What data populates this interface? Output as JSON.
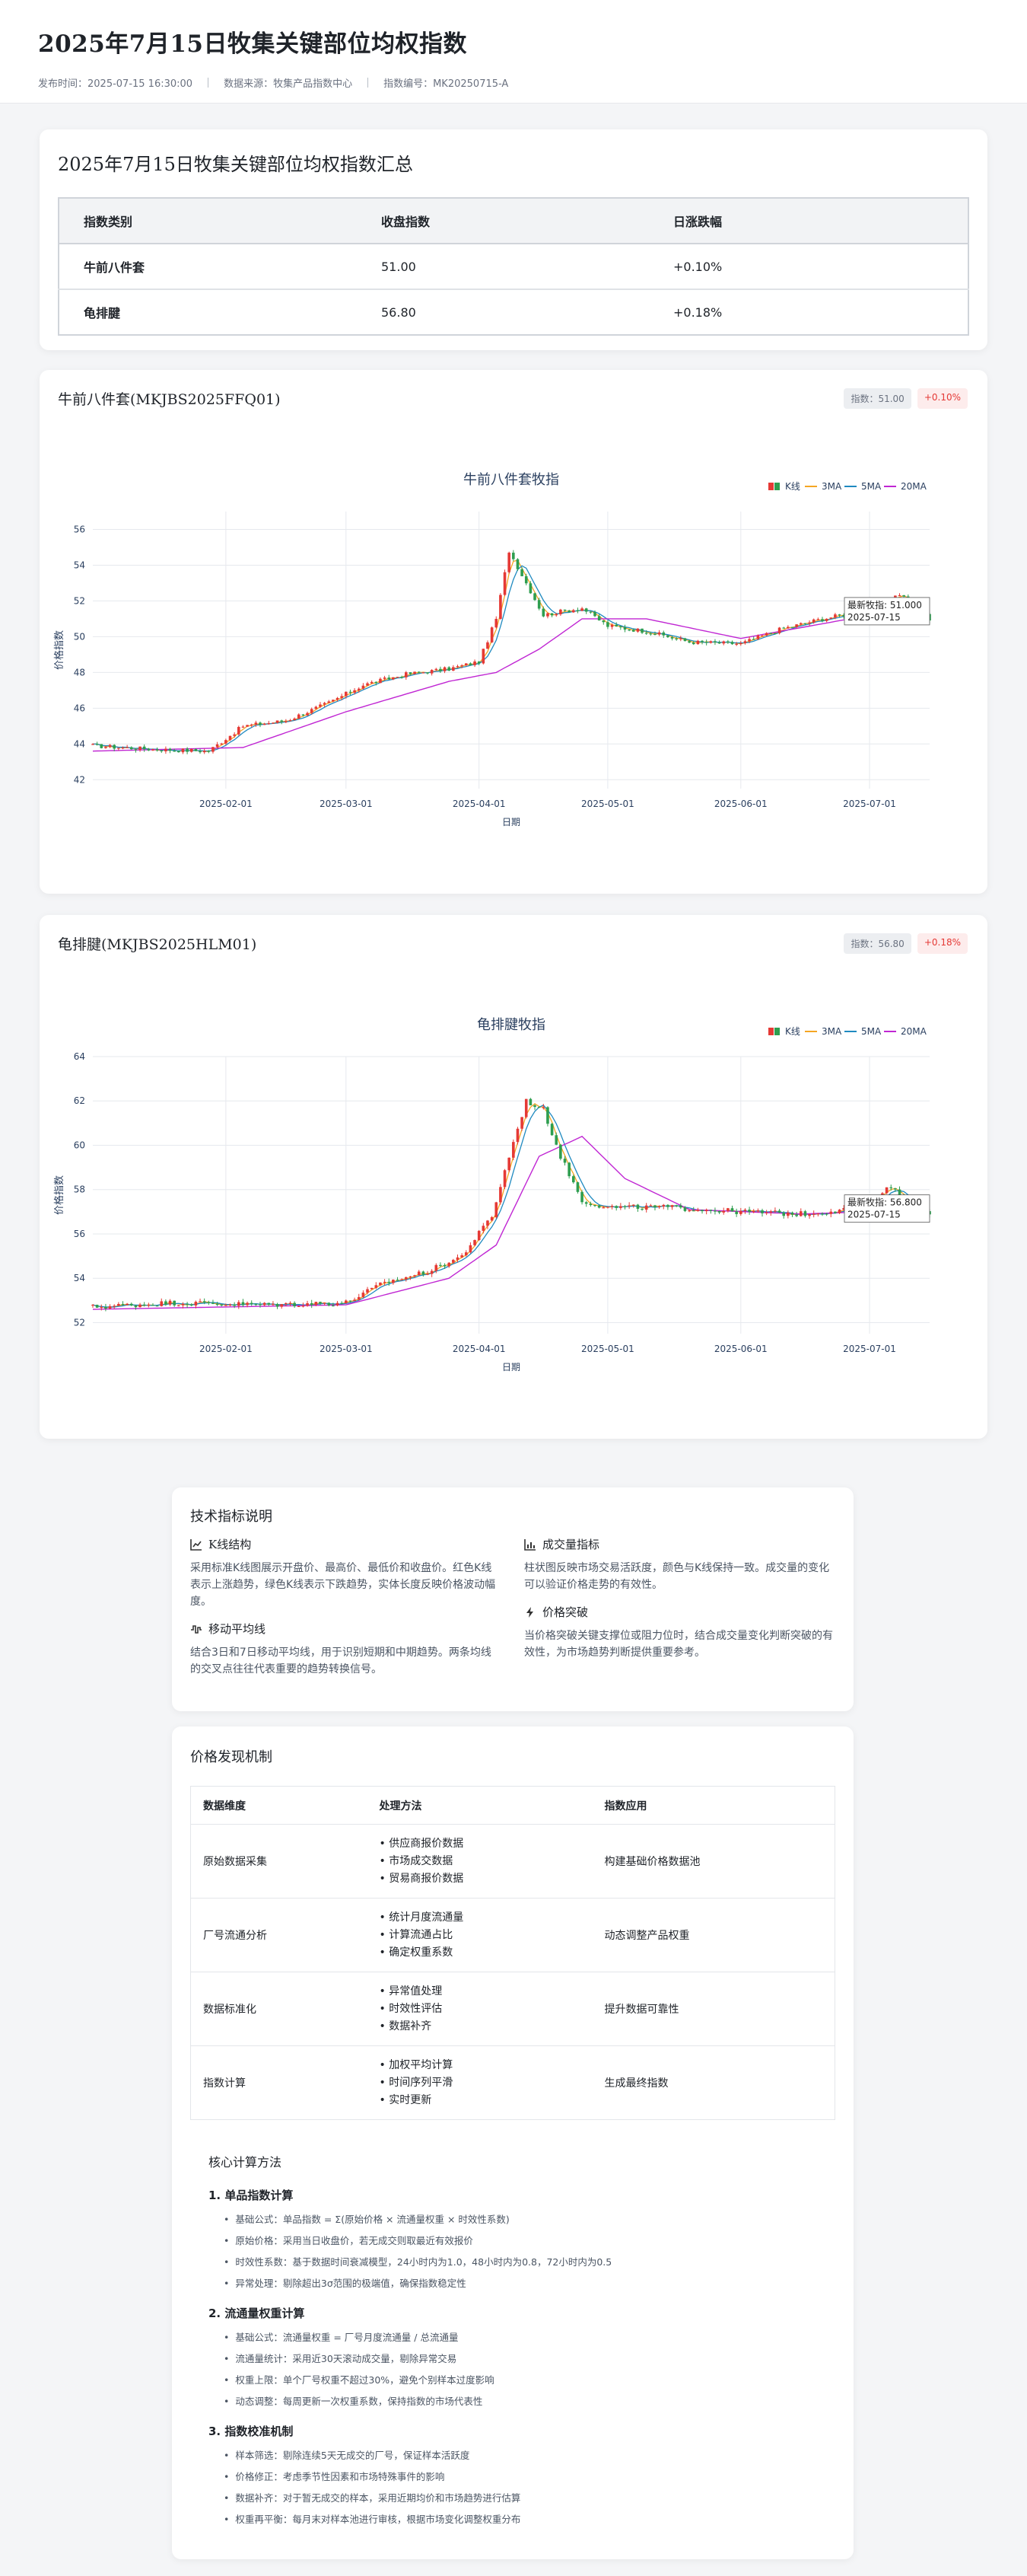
{
  "header": {
    "title": "2025年7月15日牧集关键部位均权指数",
    "publish_time": "发布时间：2025-07-15 16:30:00",
    "source": "数据来源：牧集产品指数中心",
    "index_no": "指数编号：MK20250715-A"
  },
  "summary": {
    "title": "2025年7月15日牧集关键部位均权指数汇总",
    "headers": [
      "指数类别",
      "收盘指数",
      "日涨跌幅"
    ],
    "rows": [
      [
        "牛前八件套",
        "51.00",
        "+0.10%"
      ],
      [
        "龟排腱",
        "56.80",
        "+0.18%"
      ]
    ]
  },
  "charts": [
    {
      "card_title": "牛前八件套(MKJBS2025FFQ01)",
      "badge_index": "指数：51.00",
      "badge_change": "+0.10%"
    },
    {
      "card_title": "龟排腱(MKJBS2025HLM01)",
      "badge_index": "指数：56.80",
      "badge_change": "+0.18%"
    }
  ],
  "chart_data": [
    {
      "type": "line",
      "title": "牛前八件套牧指",
      "xlabel": "日期",
      "ylabel": "价格指数",
      "x_ticks": [
        "2025-02-01",
        "2025-03-01",
        "2025-04-01",
        "2025-05-01",
        "2025-06-01",
        "2025-07-01"
      ],
      "ylim": [
        41.5,
        57
      ],
      "y_ticks": [
        42,
        44,
        46,
        48,
        50,
        52,
        54,
        56
      ],
      "legend": [
        "K线",
        "3MA",
        "5MA",
        "20MA"
      ],
      "legend_position": "top-right",
      "grid": true,
      "annotation": {
        "label": "最新牧指: 51.000",
        "date": "2025-07-15",
        "value": 51.0
      },
      "x_range": [
        "2025-01-01",
        "2025-07-15"
      ],
      "series": [
        {
          "name": "K线",
          "x": [
            "2025-01-01",
            "2025-01-15",
            "2025-01-28",
            "2025-02-05",
            "2025-02-15",
            "2025-02-25",
            "2025-03-05",
            "2025-03-15",
            "2025-03-25",
            "2025-04-01",
            "2025-04-05",
            "2025-04-08",
            "2025-04-12",
            "2025-04-16",
            "2025-04-20",
            "2025-04-25",
            "2025-05-01",
            "2025-05-10",
            "2025-05-20",
            "2025-06-01",
            "2025-06-10",
            "2025-06-20",
            "2025-07-01",
            "2025-07-08",
            "2025-07-15"
          ],
          "values": [
            43.9,
            43.7,
            43.6,
            45.0,
            45.3,
            46.3,
            47.3,
            47.9,
            48.2,
            48.6,
            51.0,
            54.8,
            53.0,
            51.2,
            51.4,
            51.6,
            50.6,
            50.3,
            49.7,
            49.6,
            50.4,
            51.0,
            51.5,
            52.4,
            51.0
          ]
        },
        {
          "name": "20MA",
          "x": [
            "2025-01-01",
            "2025-02-05",
            "2025-03-01",
            "2025-03-25",
            "2025-04-05",
            "2025-04-15",
            "2025-04-25",
            "2025-05-10",
            "2025-06-01",
            "2025-07-01",
            "2025-07-15"
          ],
          "values": [
            43.6,
            43.8,
            45.8,
            47.5,
            48.0,
            49.3,
            51.0,
            51.0,
            49.9,
            51.2,
            51.6
          ]
        }
      ]
    },
    {
      "type": "line",
      "title": "龟排腱牧指",
      "xlabel": "日期",
      "ylabel": "价格指数",
      "x_ticks": [
        "2025-02-01",
        "2025-03-01",
        "2025-04-01",
        "2025-05-01",
        "2025-06-01",
        "2025-07-01"
      ],
      "ylim": [
        51.5,
        64
      ],
      "y_ticks": [
        52,
        54,
        56,
        58,
        60,
        62,
        64
      ],
      "legend": [
        "K线",
        "3MA",
        "5MA",
        "20MA"
      ],
      "legend_position": "top-right",
      "grid": true,
      "annotation": {
        "label": "最新牧指: 56.800",
        "date": "2025-07-15",
        "value": 56.8
      },
      "x_range": [
        "2025-01-01",
        "2025-07-15"
      ],
      "series": [
        {
          "name": "K线",
          "x": [
            "2025-01-01",
            "2025-01-20",
            "2025-02-10",
            "2025-03-01",
            "2025-03-10",
            "2025-03-20",
            "2025-03-28",
            "2025-04-04",
            "2025-04-08",
            "2025-04-12",
            "2025-04-16",
            "2025-04-20",
            "2025-04-25",
            "2025-05-01",
            "2025-05-15",
            "2025-06-01",
            "2025-06-15",
            "2025-07-01",
            "2025-07-05",
            "2025-07-10",
            "2025-07-15"
          ],
          "values": [
            52.7,
            52.9,
            52.8,
            52.9,
            53.8,
            54.3,
            55.0,
            56.8,
            59.5,
            62.0,
            61.6,
            59.5,
            57.5,
            57.2,
            57.2,
            57.0,
            56.9,
            57.2,
            58.2,
            57.5,
            56.8
          ]
        },
        {
          "name": "20MA",
          "x": [
            "2025-01-01",
            "2025-03-01",
            "2025-03-25",
            "2025-04-05",
            "2025-04-15",
            "2025-04-25",
            "2025-05-05",
            "2025-05-20",
            "2025-06-15",
            "2025-07-01",
            "2025-07-15"
          ],
          "values": [
            52.6,
            52.8,
            54.0,
            55.5,
            59.5,
            60.4,
            58.5,
            57.1,
            56.9,
            57.0,
            57.5
          ]
        }
      ]
    }
  ],
  "tech": {
    "title": "技术指标说明",
    "items": [
      {
        "icon": "chart-line-icon",
        "title": "K线结构",
        "text": "采用标准K线图展示开盘价、最高价、最低价和收盘价。红色K线表示上涨趋势，绿色K线表示下跌趋势，实体长度反映价格波动幅度。"
      },
      {
        "icon": "bar-chart-icon",
        "title": "成交量指标",
        "text": "柱状图反映市场交易活跃度，颜色与K线保持一致。成交量的变化可以验证价格走势的有效性。"
      },
      {
        "icon": "wave-icon",
        "title": "移动平均线",
        "text": "结合3日和7日移动平均线，用于识别短期和中期趋势。两条均线的交叉点往往代表重要的趋势转换信号。"
      },
      {
        "icon": "bolt-icon",
        "title": "价格突破",
        "text": "当价格突破关键支撑位或阻力位时，结合成交量变化判断突破的有效性，为市场趋势判断提供重要参考。"
      }
    ]
  },
  "mechanism": {
    "title": "价格发现机制",
    "headers": [
      "数据维度",
      "处理方法",
      "指数应用"
    ],
    "rows": [
      {
        "dim": "原始数据采集",
        "methods": [
          "供应商报价数据",
          "市场成交数据",
          "贸易商报价数据"
        ],
        "app": "构建基础价格数据池"
      },
      {
        "dim": "厂号流通分析",
        "methods": [
          "统计月度流通量",
          "计算流通占比",
          "确定权重系数"
        ],
        "app": "动态调整产品权重"
      },
      {
        "dim": "数据标准化",
        "methods": [
          "异常值处理",
          "时效性评估",
          "数据补齐"
        ],
        "app": "提升数据可靠性"
      },
      {
        "dim": "指数计算",
        "methods": [
          "加权平均计算",
          "时间序列平滑",
          "实时更新"
        ],
        "app": "生成最终指数"
      }
    ],
    "calc_title": "核心计算方法",
    "sections": [
      {
        "title": "1. 单品指数计算",
        "items": [
          "基础公式：单品指数 = Σ(原始价格 × 流通量权重 × 时效性系数)",
          "原始价格：采用当日收盘价，若无成交则取最近有效报价",
          "时效性系数：基于数据时间衰减模型，24小时内为1.0，48小时内为0.8，72小时内为0.5",
          "异常处理：剔除超出3σ范围的极端值，确保指数稳定性"
        ]
      },
      {
        "title": "2. 流通量权重计算",
        "items": [
          "基础公式：流通量权重 = 厂号月度流通量 / 总流通量",
          "流通量统计：采用近30天滚动成交量，剔除异常交易",
          "权重上限：单个厂号权重不超过30%，避免个别样本过度影响",
          "动态调整：每周更新一次权重系数，保持指数的市场代表性"
        ]
      },
      {
        "title": "3. 指数校准机制",
        "items": [
          "样本筛选：剔除连续5天无成交的厂号，保证样本活跃度",
          "价格修正：考虑季节性因素和市场特殊事件的影响",
          "数据补齐：对于暂无成交的样本，采用近期均价和市场趋势进行估算",
          "权重再平衡：每月末对样本池进行审核，根据市场变化调整权重分布"
        ]
      }
    ]
  },
  "colors": {
    "up": "#e53935",
    "down": "#2e9e4f",
    "ma3": "#f5a623",
    "ma5": "#1f8ac0",
    "ma20": "#c026d3"
  }
}
